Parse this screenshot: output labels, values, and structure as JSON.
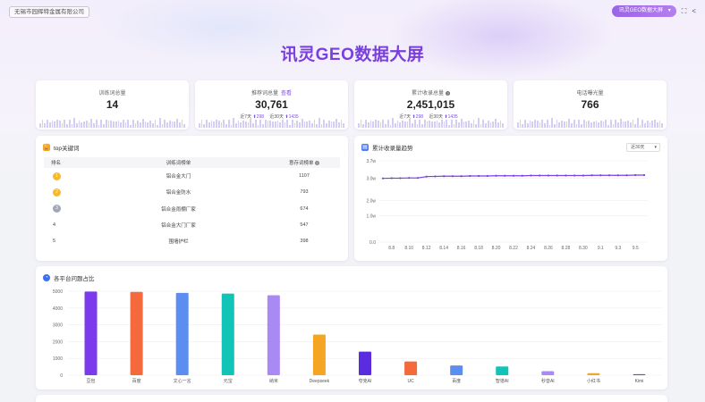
{
  "header": {
    "company": "无锡市园辉特金属有限公司",
    "title": "讯灵GEO数据大屏",
    "screen_select": "讯灵GEO数据大屏",
    "colors": {
      "accent": "#7b4be8",
      "title": "#7a3fe0"
    }
  },
  "stats": [
    {
      "label": "训练词总量",
      "value": "14"
    },
    {
      "label": "推荐词总量",
      "link": "查看",
      "value": "30,761",
      "sub7_label": "近7天",
      "sub7": "298",
      "sub30_label": "近30天",
      "sub30": "1435"
    },
    {
      "label": "累计收录总量",
      "value": "2,451,015",
      "sub7_label": "近7天",
      "sub7": "298",
      "sub30_label": "近30天",
      "sub30": "1435"
    },
    {
      "label": "电话曝光量",
      "value": "766"
    }
  ],
  "keywords": {
    "title": "top关键词",
    "headers": [
      "排名",
      "训练词榜单",
      "意存词榜单"
    ],
    "rows": [
      {
        "rank": "1",
        "word": "铝合金大门",
        "count": "1107"
      },
      {
        "rank": "2",
        "word": "铝合金防水",
        "count": "793"
      },
      {
        "rank": "3",
        "word": "铝合金雨棚厂家",
        "count": "674"
      },
      {
        "rank": "4",
        "word": "铝合金大门厂家",
        "count": "547"
      },
      {
        "rank": "5",
        "word": "围墙护栏",
        "count": "398"
      }
    ]
  },
  "trend_title": "累计收录量趋势",
  "trend_range": "近30天",
  "platform_title": "各平台问题占比",
  "chart_data": [
    {
      "type": "line",
      "title": "累计收录量趋势",
      "x": [
        "8.7",
        "8.8",
        "8.9",
        "8.10",
        "8.11",
        "8.12",
        "8.13",
        "8.14",
        "8.15",
        "8.16",
        "8.17",
        "8.18",
        "8.19",
        "8.20",
        "8.21",
        "8.22",
        "8.23",
        "8.24",
        "8.25",
        "8.26",
        "8.27",
        "8.28",
        "8.29",
        "8.30",
        "8.31",
        "9.1",
        "9.2",
        "9.3",
        "9.4",
        "9.5",
        "9.6"
      ],
      "x_tick_labels": [
        "8.8",
        "8.10",
        "8.12",
        "8.14",
        "8.16",
        "8.18",
        "8.20",
        "8.22",
        "8.24",
        "8.26",
        "8.28",
        "8.30",
        "9.1",
        "9.3",
        "9.5"
      ],
      "values": [
        29000,
        29100,
        29100,
        29200,
        29200,
        29800,
        29900,
        30000,
        30000,
        30000,
        30100,
        30100,
        30100,
        30200,
        30200,
        30200,
        30200,
        30300,
        30300,
        30300,
        30300,
        30300,
        30300,
        30300,
        30400,
        30400,
        30400,
        30400,
        30400,
        30500,
        30500
      ],
      "ylim": [
        0,
        37000
      ],
      "y_ticks": [
        {
          "v": 0,
          "label": "0.0"
        },
        {
          "v": 12000,
          "label": "1.0w"
        },
        {
          "v": 19000,
          "label": "2.0w"
        },
        {
          "v": 29000,
          "label": "3.0w"
        },
        {
          "v": 37000,
          "label": "3.7w"
        }
      ],
      "color": "#7b3fe4",
      "grid": true
    },
    {
      "type": "bar",
      "title": "各平台问题占比",
      "categories": [
        "豆包",
        "百度",
        "文心一言",
        "元宝",
        "纳米",
        "Deepseek",
        "夸克AI",
        "UC",
        "百度",
        "智谱AI",
        "秒音AI",
        "小红书",
        "Kimi"
      ],
      "values": [
        4980,
        4960,
        4900,
        4860,
        4760,
        2420,
        1400,
        820,
        580,
        520,
        240,
        120,
        60
      ],
      "colors": [
        "#7c3aed",
        "#f46a3c",
        "#5b8ef0",
        "#12c3b8",
        "#a98af5",
        "#f5a524",
        "#5b2be0",
        "#f46a3c",
        "#5b8ef0",
        "#12c3b8",
        "#a98af5",
        "#f5a524",
        "#7c3aed"
      ],
      "ylim": [
        0,
        5000
      ],
      "y_ticks": [
        0,
        1000,
        2000,
        3000,
        4000,
        5000
      ],
      "grid": true
    }
  ]
}
